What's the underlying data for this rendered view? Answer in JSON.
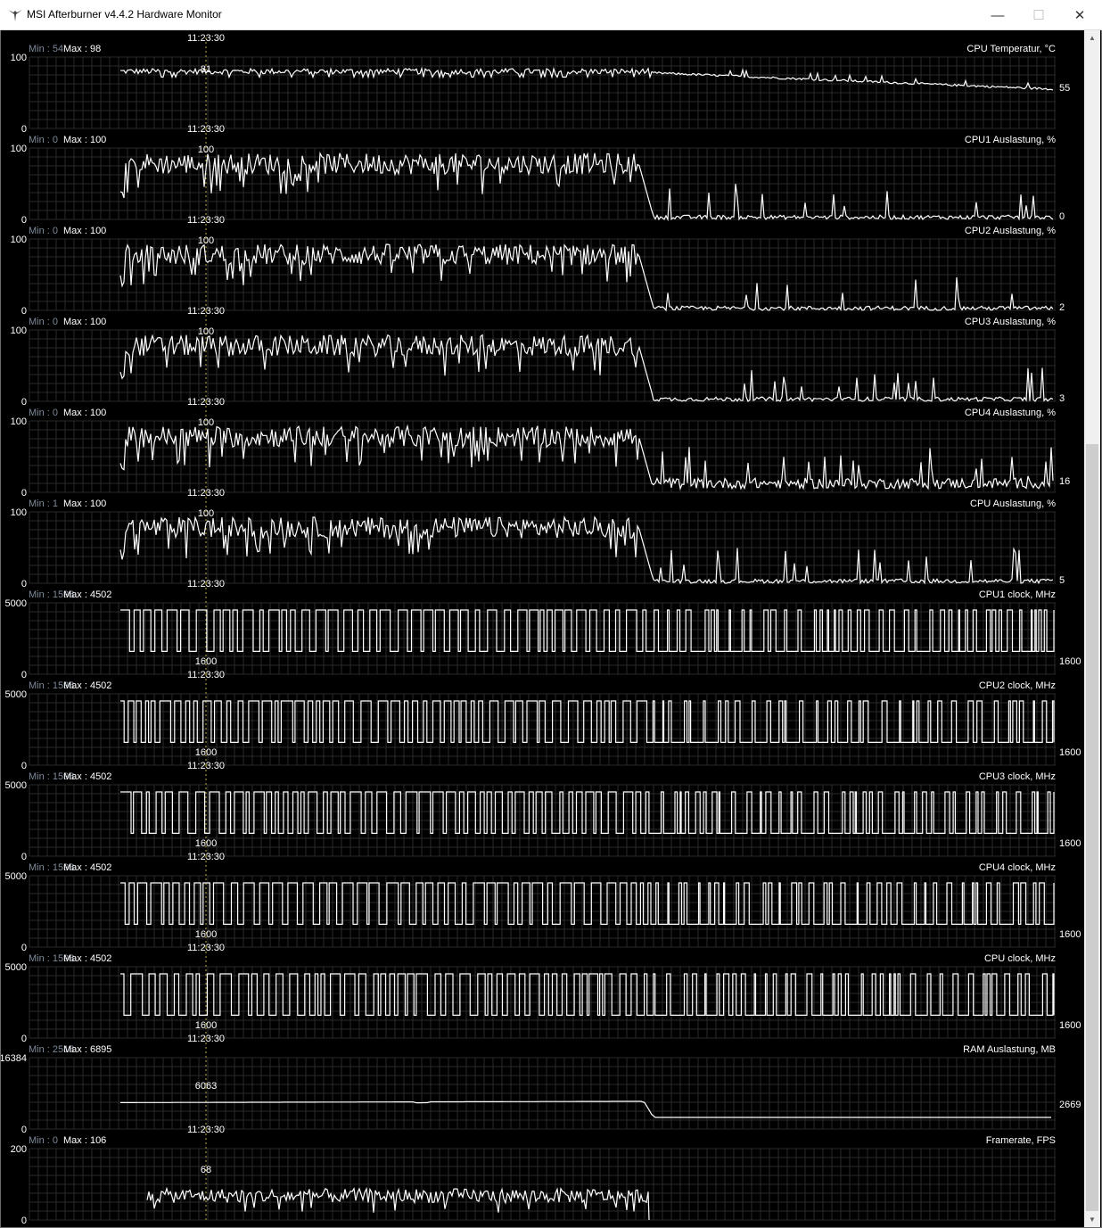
{
  "window": {
    "title": "MSI Afterburner v4.4.2 Hardware Monitor",
    "minimize_glyph": "—",
    "maximize_glyph": "☐",
    "close_glyph": "✕"
  },
  "scrollbar": {
    "up_glyph": "▲",
    "down_glyph": "▼"
  },
  "colors": {
    "background": "#000000",
    "grid": "#2a2a2a",
    "line": "#ffffff",
    "minmax_label": "#7d8a9a",
    "text": "#ffffff",
    "cursor": "#b8b040"
  },
  "cursor_time": "11:23:30",
  "graphs": [
    {
      "id": "cpu-temp",
      "title": "CPU Temperatur, °C",
      "min_label": "Min : ",
      "min": "54",
      "max_label": "Max : ",
      "max": "98",
      "scale_top": "100",
      "scale_bottom": "0",
      "time": "11:23:30",
      "cursor_value": "81",
      "current_value": "55",
      "profile": "temp",
      "level_lo": 81,
      "level_end": 55
    },
    {
      "id": "cpu1-usage",
      "title": "CPU1 Auslastung, %",
      "min_label": "Min : ",
      "min": "0",
      "max_label": "Max : ",
      "max": "100",
      "scale_top": "100",
      "scale_bottom": "0",
      "time": "11:23:30",
      "cursor_value": "100",
      "current_value": "0",
      "profile": "usage",
      "level_lo": 72,
      "level_end": 0
    },
    {
      "id": "cpu2-usage",
      "title": "CPU2 Auslastung, %",
      "min_label": "Min : ",
      "min": "0",
      "max_label": "Max : ",
      "max": "100",
      "scale_top": "100",
      "scale_bottom": "0",
      "time": "11:23:30",
      "cursor_value": "100",
      "current_value": "2",
      "profile": "usage",
      "level_lo": 72,
      "level_end": 2
    },
    {
      "id": "cpu3-usage",
      "title": "CPU3 Auslastung, %",
      "min_label": "Min : ",
      "min": "0",
      "max_label": "Max : ",
      "max": "100",
      "scale_top": "100",
      "scale_bottom": "0",
      "time": "11:23:30",
      "cursor_value": "100",
      "current_value": "3",
      "profile": "usage",
      "level_lo": 72,
      "level_end": 3
    },
    {
      "id": "cpu4-usage",
      "title": "CPU4 Auslastung, %",
      "min_label": "Min : ",
      "min": "0",
      "max_label": "Max : ",
      "max": "100",
      "scale_top": "100",
      "scale_bottom": "0",
      "time": "11:23:30",
      "cursor_value": "100",
      "current_value": "16",
      "profile": "usage-busy",
      "level_lo": 72,
      "level_end": 16
    },
    {
      "id": "cpu-usage",
      "title": "CPU Auslastung, %",
      "min_label": "Min : ",
      "min": "1",
      "max_label": "Max : ",
      "max": "100",
      "scale_top": "100",
      "scale_bottom": "0",
      "time": "11:23:30",
      "cursor_value": "100",
      "current_value": "5",
      "profile": "usage",
      "level_lo": 72,
      "level_end": 5
    },
    {
      "id": "cpu1-clock",
      "title": "CPU1 clock, MHz",
      "min_label": "Min : ",
      "min": "1598",
      "max_label": "Max : ",
      "max": "4502",
      "scale_top": "5000",
      "scale_bottom": "0",
      "time": "11:23:30",
      "cursor_value": "1600",
      "current_value": "1600",
      "profile": "clock",
      "hi": 4502,
      "lo": 1600
    },
    {
      "id": "cpu2-clock",
      "title": "CPU2 clock, MHz",
      "min_label": "Min : ",
      "min": "1598",
      "max_label": "Max : ",
      "max": "4502",
      "scale_top": "5000",
      "scale_bottom": "0",
      "time": "11:23:30",
      "cursor_value": "1600",
      "current_value": "1600",
      "profile": "clock",
      "hi": 4502,
      "lo": 1600
    },
    {
      "id": "cpu3-clock",
      "title": "CPU3 clock, MHz",
      "min_label": "Min : ",
      "min": "1598",
      "max_label": "Max : ",
      "max": "4502",
      "scale_top": "5000",
      "scale_bottom": "0",
      "time": "11:23:30",
      "cursor_value": "1600",
      "current_value": "1600",
      "profile": "clock",
      "hi": 4502,
      "lo": 1600
    },
    {
      "id": "cpu4-clock",
      "title": "CPU4 clock, MHz",
      "min_label": "Min : ",
      "min": "1598",
      "max_label": "Max : ",
      "max": "4502",
      "scale_top": "5000",
      "scale_bottom": "0",
      "time": "11:23:30",
      "cursor_value": "1600",
      "current_value": "1600",
      "profile": "clock",
      "hi": 4502,
      "lo": 1600
    },
    {
      "id": "cpu-clock",
      "title": "CPU clock, MHz",
      "min_label": "Min : ",
      "min": "1598",
      "max_label": "Max : ",
      "max": "4502",
      "scale_top": "5000",
      "scale_bottom": "0",
      "time": "11:23:30",
      "cursor_value": "1600",
      "current_value": "1600",
      "profile": "clock",
      "hi": 4502,
      "lo": 1600
    },
    {
      "id": "ram-usage",
      "title": "RAM Auslastung, MB",
      "min_label": "Min : ",
      "min": "2518",
      "max_label": "Max : ",
      "max": "6895",
      "scale_top": "16384",
      "scale_bottom": "0",
      "time": "11:23:30",
      "cursor_value": "6063",
      "current_value": "2669",
      "profile": "ram",
      "level_lo": 6063,
      "level_end": 2669
    },
    {
      "id": "framerate",
      "title": "Framerate, FPS",
      "min_label": "Min : ",
      "min": "0",
      "max_label": "Max : ",
      "max": "106",
      "scale_top": "200",
      "scale_bottom": "0",
      "time": "11:23:30",
      "cursor_value": "68",
      "current_value": "",
      "profile": "fps",
      "level_lo": 68,
      "level_end": 0
    }
  ]
}
